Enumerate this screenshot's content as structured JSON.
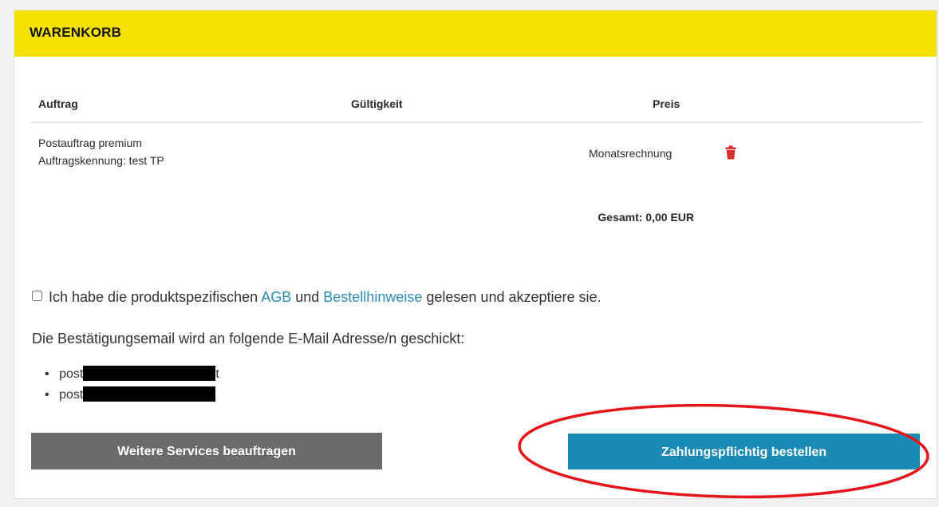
{
  "header": {
    "title": "WARENKORB"
  },
  "table": {
    "columns": {
      "order": "Auftrag",
      "validity": "Gültigkeit",
      "price": "Preis"
    },
    "rows": [
      {
        "product": "Postauftrag premium",
        "identifier": "Auftragskennung: test TP",
        "validity": "",
        "price": "Monatsrechnung",
        "delete_icon": "trash-icon"
      }
    ],
    "total": "Gesamt: 0,00 EUR"
  },
  "consent": {
    "checked": false,
    "text_before": "Ich habe die produktspezifischen",
    "link_agb": "AGB",
    "text_and": "und",
    "link_hints": "Bestellhinweise",
    "text_after": "gelesen und akzeptiere sie."
  },
  "confirmation": {
    "text": "Die Bestätigungsemail wird an folgende E-Mail Adresse/n geschickt:",
    "emails": [
      {
        "prefix": "post",
        "suffix": "t"
      },
      {
        "prefix": "post",
        "suffix": ""
      }
    ]
  },
  "actions": {
    "more_services": "Weitere Services beauftragen",
    "order_paid": "Zahlungspflichtig bestellen"
  },
  "colors": {
    "header_bg": "#f5e200",
    "link": "#2d8cb5",
    "primary_button": "#1a8bb5",
    "secondary_button": "#6b6b6b",
    "delete_icon": "#d9302c",
    "annotation": "#e8141c"
  }
}
